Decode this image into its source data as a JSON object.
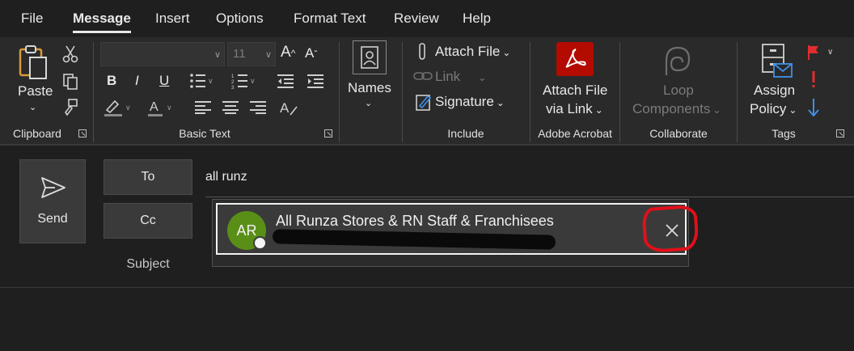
{
  "tabs": [
    "File",
    "Message",
    "Insert",
    "Options",
    "Format Text",
    "Review",
    "Help"
  ],
  "active_tab": "Message",
  "ribbon": {
    "clipboard": {
      "paste_label": "Paste",
      "group_label": "Clipboard"
    },
    "basic_text": {
      "font_size": "11",
      "group_label": "Basic Text"
    },
    "names": {
      "label": "Names"
    },
    "include": {
      "attach_file": "Attach File",
      "link": "Link",
      "signature": "Signature",
      "group_label": "Include"
    },
    "adobe": {
      "line1": "Attach File",
      "line2": "via Link",
      "group_label": "Adobe Acrobat"
    },
    "collaborate": {
      "line1": "Loop",
      "line2": "Components",
      "group_label": "Collaborate"
    },
    "tags": {
      "line1": "Assign",
      "line2": "Policy",
      "group_label": "Tags"
    }
  },
  "compose": {
    "send_label": "Send",
    "to_label": "To",
    "cc_label": "Cc",
    "subject_label": "Subject",
    "to_value": "all runz"
  },
  "suggestion": {
    "initials": "AR",
    "name": "All Runza Stores & RN Staff & Franchisees"
  },
  "colors": {
    "avatar": "#5a8f17",
    "adobe_red": "#b30b00",
    "flag_red": "#e02e2e",
    "importance_red": "#e02e2e",
    "low_importance_blue": "#3f8fe6",
    "annotation_red": "#e0101a"
  },
  "icons": [
    "paste-icon",
    "cut-icon",
    "copy-icon",
    "format-painter-icon",
    "names-icon",
    "paperclip-icon",
    "link-icon",
    "signature-icon",
    "adobe-acrobat-icon",
    "loop-icon",
    "assign-policy-icon",
    "flag-icon",
    "high-importance-icon",
    "low-importance-icon",
    "send-icon",
    "close-icon"
  ]
}
